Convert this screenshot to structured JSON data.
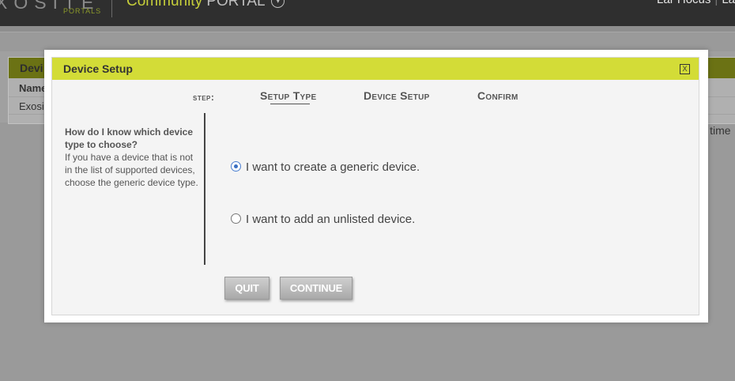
{
  "app": {
    "logo_main": "XOSITE",
    "logo_sub": "PORTALS",
    "portal_title_part1": "Community",
    "portal_title_part2": "PORTAL",
    "portal_caret": "▾",
    "user_text": "Lar Hocus",
    "user_sep": "|",
    "user_tail": "La"
  },
  "background": {
    "card_title": "Devi",
    "row_header": "Name",
    "row_value": "Exosi",
    "all_time": "ll time"
  },
  "modal": {
    "title": "Device Setup",
    "close_glyph": "X",
    "step_label": "step:",
    "steps": [
      "Setup Type",
      "Device Setup",
      "Confirm"
    ],
    "help_question": "How do I know which device type to choose?",
    "help_text": "If you have a device that is not in the list of supported devices, choose the generic device type.",
    "options": [
      {
        "label": "I want to create a generic device.",
        "selected": true
      },
      {
        "label": "I want to add an unlisted device.",
        "selected": false
      }
    ],
    "buttons": {
      "quit": "QUIT",
      "continue": "CONTINUE"
    }
  },
  "colors": {
    "accent": "#d3dc37",
    "radio_selected": "#3a6fc2"
  }
}
